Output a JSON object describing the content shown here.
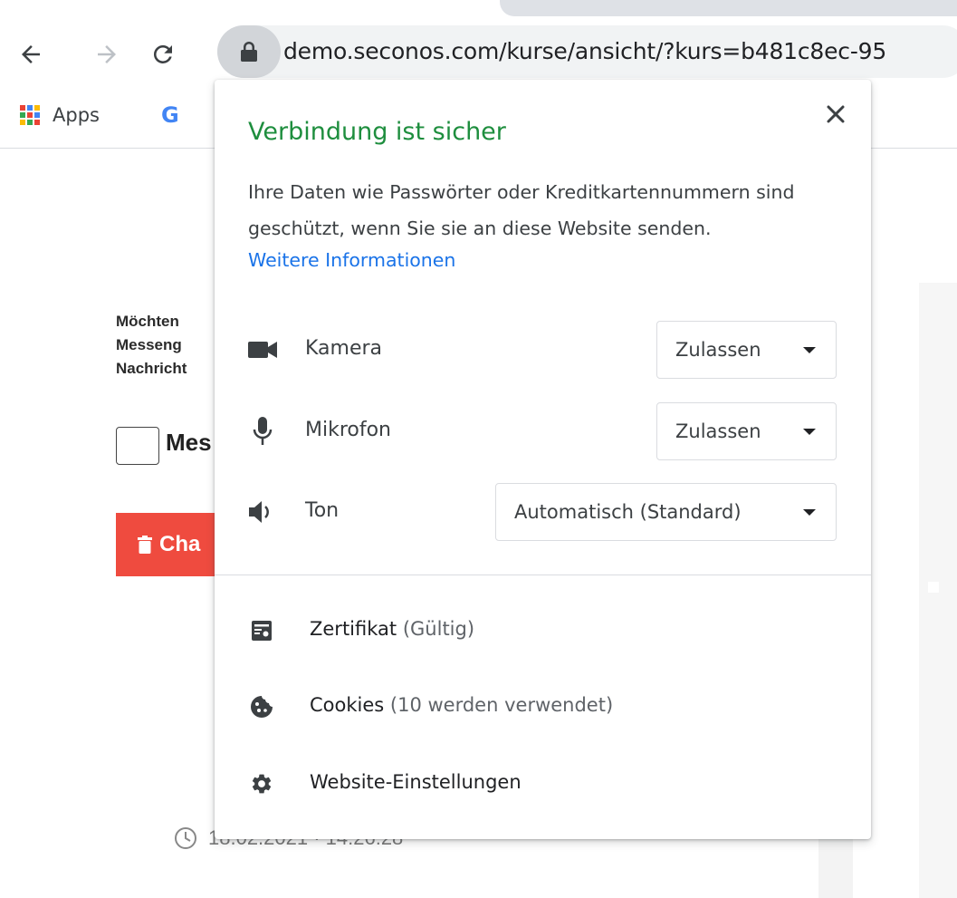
{
  "browser": {
    "url": "demo.seconos.com/kurse/ansicht/?kurs=b481c8ec-95",
    "bookmarks": [
      {
        "label": "Apps"
      },
      {
        "label": "G"
      }
    ]
  },
  "page": {
    "text_lines": [
      "Möchten",
      "Messeng",
      "Nachricht"
    ],
    "checkbox_label": "Mes",
    "red_button_label": "Cha",
    "date_text": "18.02.2021 · 14:26:28"
  },
  "popup": {
    "title": "Verbindung ist sicher",
    "description": "Ihre Daten wie Passwörter oder Kreditkartennummern sind geschützt, wenn Sie sie an diese Website senden.",
    "link": "Weitere Informationen",
    "close_icon": "close-icon",
    "permissions": [
      {
        "icon": "camera-icon",
        "label": "Kamera",
        "value": "Zulassen"
      },
      {
        "icon": "microphone-icon",
        "label": "Mikrofon",
        "value": "Zulassen"
      },
      {
        "icon": "sound-icon",
        "label": "Ton",
        "value": "Automatisch (Standard)"
      }
    ],
    "info_items": [
      {
        "icon": "certificate-icon",
        "label": "Zertifikat",
        "sub": "(Gültig)"
      },
      {
        "icon": "cookie-icon",
        "label": "Cookies",
        "sub": "(10 werden verwendet)"
      },
      {
        "icon": "gear-icon",
        "label": "Website-Einstellungen",
        "sub": ""
      }
    ]
  },
  "colors": {
    "secure_green": "#1e8e3e",
    "link_blue": "#1a73e8",
    "danger_red": "#ef4b3f"
  }
}
